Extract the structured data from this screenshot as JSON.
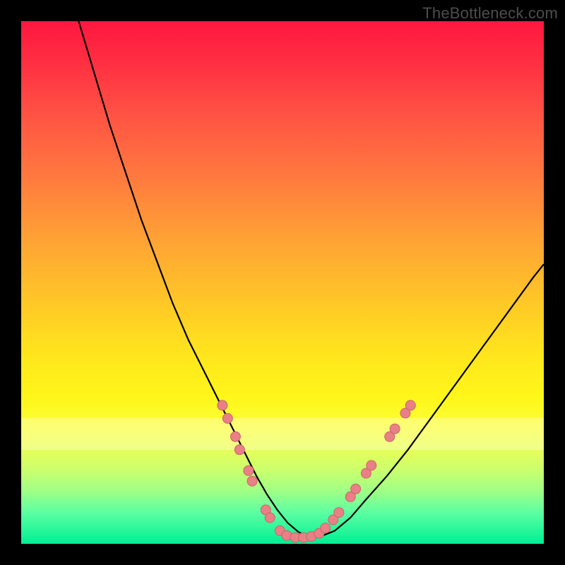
{
  "watermark": "TheBottleneck.com",
  "colors": {
    "curve": "#000000",
    "dot_fill": "#e98085",
    "dot_stroke": "#c9646b"
  },
  "chart_data": {
    "type": "line",
    "title": "",
    "xlabel": "",
    "ylabel": "",
    "xlim": [
      0,
      100
    ],
    "ylim": [
      0,
      100
    ],
    "x": [
      11,
      14,
      17,
      20,
      23,
      26,
      29,
      32,
      35,
      38,
      41,
      43,
      45,
      47,
      49,
      51,
      53,
      55,
      57,
      60,
      63,
      66,
      70,
      74,
      78,
      82,
      86,
      90,
      94,
      98,
      100
    ],
    "y": [
      100,
      90,
      80,
      71,
      62,
      54,
      46,
      39,
      33,
      27,
      21,
      17,
      13,
      9.5,
      6.5,
      4.0,
      2.3,
      1.3,
      1.3,
      2.5,
      5.0,
      8.5,
      13,
      18,
      23.5,
      29,
      34.5,
      40,
      45.5,
      51,
      53.5
    ],
    "flat_bottom": {
      "x_start": 44,
      "x_end": 52,
      "y": 1.0
    },
    "dots": [
      {
        "x": 38.5,
        "y": 26.5
      },
      {
        "x": 39.5,
        "y": 24.0
      },
      {
        "x": 41.0,
        "y": 20.5
      },
      {
        "x": 41.8,
        "y": 18.0
      },
      {
        "x": 43.5,
        "y": 14.0
      },
      {
        "x": 44.2,
        "y": 12.0
      },
      {
        "x": 46.8,
        "y": 6.5
      },
      {
        "x": 47.6,
        "y": 5.0
      },
      {
        "x": 49.5,
        "y": 2.5
      },
      {
        "x": 50.8,
        "y": 1.6
      },
      {
        "x": 52.4,
        "y": 1.2
      },
      {
        "x": 54.0,
        "y": 1.2
      },
      {
        "x": 55.5,
        "y": 1.4
      },
      {
        "x": 57.0,
        "y": 2.0
      },
      {
        "x": 58.2,
        "y": 3.0
      },
      {
        "x": 59.7,
        "y": 4.6
      },
      {
        "x": 60.8,
        "y": 6.0
      },
      {
        "x": 63.0,
        "y": 9.0
      },
      {
        "x": 64.0,
        "y": 10.5
      },
      {
        "x": 66.0,
        "y": 13.5
      },
      {
        "x": 67.0,
        "y": 15.0
      },
      {
        "x": 70.5,
        "y": 20.5
      },
      {
        "x": 71.5,
        "y": 22.0
      },
      {
        "x": 73.5,
        "y": 25.0
      },
      {
        "x": 74.5,
        "y": 26.5
      }
    ]
  }
}
